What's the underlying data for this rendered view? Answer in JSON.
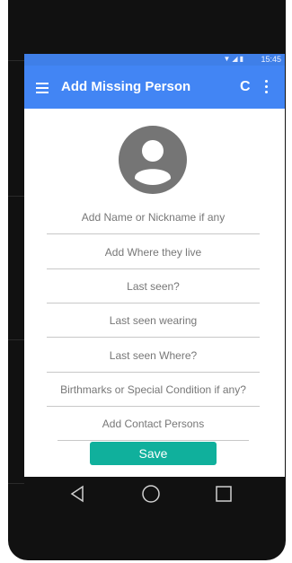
{
  "status_bar": {
    "icons": "▼◢▮",
    "time": "15:45"
  },
  "toolbar": {
    "title": "Add Missing Person",
    "menu_icon": "hamburger-icon",
    "refresh_icon": "refresh-icon",
    "overflow_icon": "more-vert-icon",
    "color": "#4285f4"
  },
  "form": {
    "fields": [
      {
        "placeholder": "Add Name or Nickname if any",
        "value": ""
      },
      {
        "placeholder": "Add Where they live",
        "value": ""
      },
      {
        "placeholder": "Last seen?",
        "value": ""
      },
      {
        "placeholder": "Last seen wearing",
        "value": ""
      },
      {
        "placeholder": "Last seen Where?",
        "value": ""
      },
      {
        "placeholder": "Birthmarks or Special Condition if any?",
        "value": ""
      },
      {
        "placeholder": "Add Contact Persons",
        "value": ""
      }
    ],
    "save_label": "Save",
    "save_color": "#10b09c"
  },
  "navbar": {
    "back_icon": "triangle-back-icon",
    "home_icon": "circle-home-icon",
    "recents_icon": "square-recents-icon"
  }
}
